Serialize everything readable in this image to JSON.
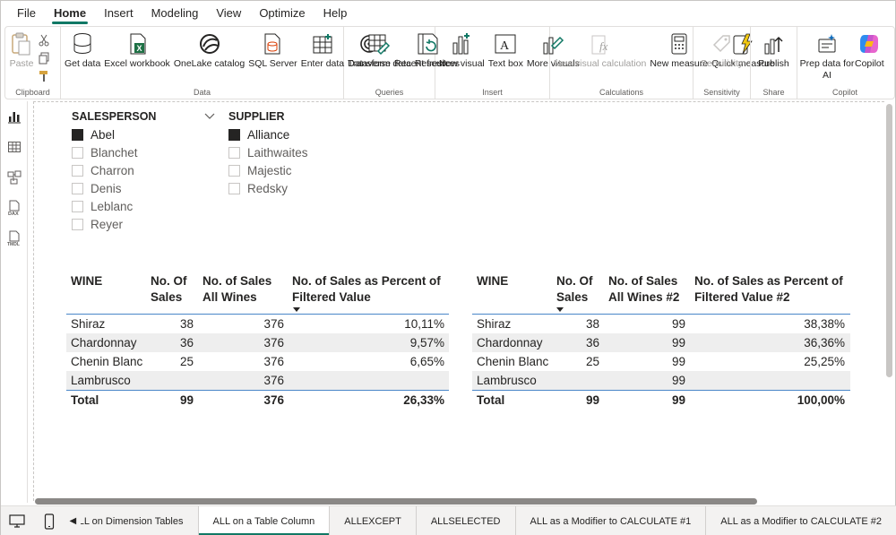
{
  "menu": {
    "tabs": [
      "File",
      "Home",
      "Insert",
      "Modeling",
      "View",
      "Optimize",
      "Help"
    ]
  },
  "ribbon": {
    "clipboard": {
      "paste": "Paste",
      "label": "Clipboard"
    },
    "data": {
      "get_data": "Get data",
      "excel": "Excel workbook",
      "onelake": "OneLake catalog",
      "sql": "SQL Server",
      "enter": "Enter data",
      "dataverse": "Dataverse",
      "recent": "Recent sources",
      "label": "Data"
    },
    "queries": {
      "transform": "Transform data",
      "refresh": "Refresh",
      "label": "Queries"
    },
    "insert": {
      "new_visual": "New visual",
      "text_box": "Text box",
      "more_visuals": "More visuals",
      "label": "Insert"
    },
    "calculations": {
      "new_visual_calc": "New visual calculation",
      "new_measure": "New measure",
      "quick_measure": "Quick measure",
      "label": "Calculations"
    },
    "sensitivity": {
      "sensitivity": "Sensitivity",
      "label": "Sensitivity"
    },
    "share": {
      "publish": "Publish",
      "label": "Share"
    },
    "copilot": {
      "prep": "Prep data for AI",
      "copilot": "Copilot",
      "label": "Copilot"
    }
  },
  "slicers": {
    "salesperson": {
      "title": "SALESPERSON",
      "items": [
        {
          "label": "Abel",
          "checked": true
        },
        {
          "label": "Blanchet",
          "checked": false
        },
        {
          "label": "Charron",
          "checked": false
        },
        {
          "label": "Denis",
          "checked": false
        },
        {
          "label": "Leblanc",
          "checked": false
        },
        {
          "label": "Reyer",
          "checked": false
        }
      ]
    },
    "supplier": {
      "title": "SUPPLIER",
      "items": [
        {
          "label": "Alliance",
          "checked": true
        },
        {
          "label": "Laithwaites",
          "checked": false
        },
        {
          "label": "Majestic",
          "checked": false
        },
        {
          "label": "Redsky",
          "checked": false
        }
      ]
    }
  },
  "table1": {
    "headers": [
      "WINE",
      "No. Of Sales",
      "No. of Sales All Wines",
      "No. of Sales as Percent of Filtered Value"
    ],
    "header_lines": [
      [
        "WINE"
      ],
      [
        "No. Of",
        "Sales"
      ],
      [
        "No. of Sales",
        "All Wines"
      ],
      [
        "No. of Sales as Percent of",
        "Filtered Value"
      ]
    ],
    "rows": [
      [
        "Shiraz",
        "38",
        "376",
        "10,11%"
      ],
      [
        "Chardonnay",
        "36",
        "376",
        "9,57%"
      ],
      [
        "Chenin Blanc",
        "25",
        "376",
        "6,65%"
      ],
      [
        "Lambrusco",
        "",
        "376",
        ""
      ]
    ],
    "total": [
      "Total",
      "99",
      "376",
      "26,33%"
    ]
  },
  "table2": {
    "headers": [
      "WINE",
      "No. Of Sales",
      "No. of Sales All Wines #2",
      "No. of Sales as Percent of Filtered Value #2"
    ],
    "header_lines": [
      [
        "WINE"
      ],
      [
        "No. Of",
        "Sales"
      ],
      [
        "No. of Sales",
        "All Wines #2"
      ],
      [
        "No. of Sales as Percent of",
        "Filtered Value #2"
      ]
    ],
    "rows": [
      [
        "Shiraz",
        "38",
        "99",
        "38,38%"
      ],
      [
        "Chardonnay",
        "36",
        "99",
        "36,36%"
      ],
      [
        "Chenin Blanc",
        "25",
        "99",
        "25,25%"
      ],
      [
        "Lambrusco",
        "",
        "99",
        ""
      ]
    ],
    "total": [
      "Total",
      "99",
      "99",
      "100,00%"
    ]
  },
  "page_tabs": [
    "ALL on Dimension Tables",
    "ALL on a Table Column",
    "ALLEXCEPT",
    "ALLSELECTED",
    "ALL as a Modifier to CALCULATE #1",
    "ALL as a Modifier to CALCULATE #2"
  ],
  "active_tab": "ALL on a Table Column",
  "colors": {
    "accent": "#117865",
    "table_rule": "#4a86c8",
    "alt_row": "#eeeeee"
  }
}
